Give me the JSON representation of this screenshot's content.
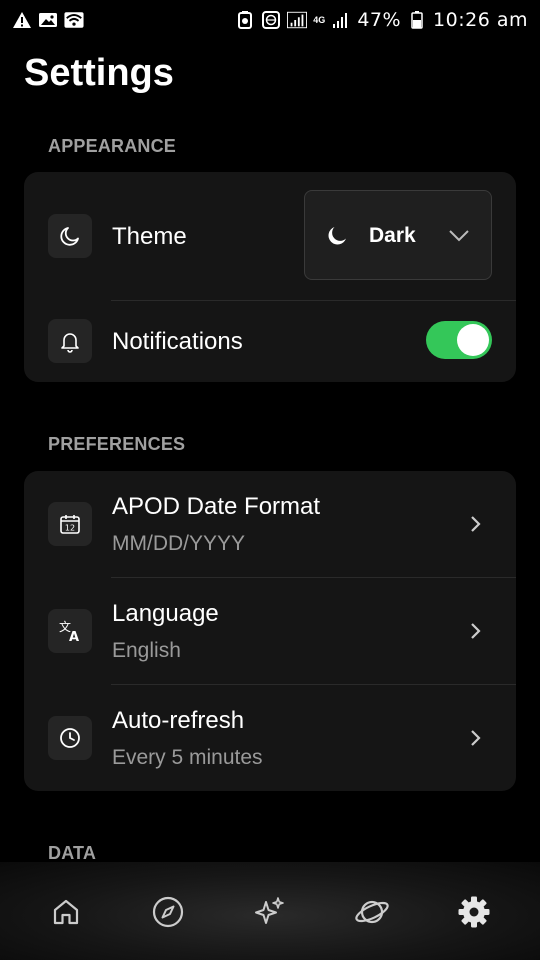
{
  "status_bar": {
    "battery": "47%",
    "time": "10:26 am",
    "network": "4G"
  },
  "page": {
    "title": "Settings"
  },
  "sections": {
    "appearance": {
      "label": "APPEARANCE",
      "theme": {
        "label": "Theme",
        "value": "Dark",
        "icon": "moon-icon"
      },
      "notifications": {
        "label": "Notifications",
        "enabled": true,
        "icon": "bell-icon"
      }
    },
    "preferences": {
      "label": "PREFERENCES",
      "items": [
        {
          "title": "APOD Date Format",
          "value": "MM/DD/YYYY",
          "icon": "calendar-icon"
        },
        {
          "title": "Language",
          "value": "English",
          "icon": "translate-icon"
        },
        {
          "title": "Auto-refresh",
          "value": "Every 5 minutes",
          "icon": "clock-icon"
        }
      ]
    },
    "data": {
      "label": "DATA"
    }
  },
  "nav": {
    "items": [
      "home-icon",
      "compass-icon",
      "sparkles-icon",
      "planet-icon",
      "settings-gear-icon"
    ],
    "active": "settings-gear-icon"
  },
  "colors": {
    "background": "#000000",
    "card": "#151515",
    "toggle_on": "#34c759",
    "muted_text": "#9a9a9a"
  }
}
